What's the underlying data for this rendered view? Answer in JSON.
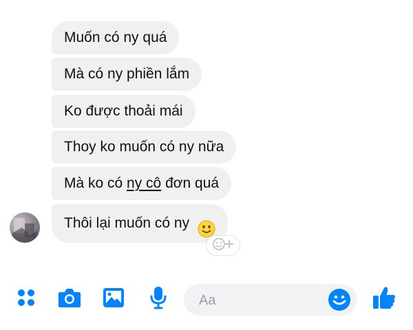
{
  "messages": [
    {
      "text": "Muốn có ny quá"
    },
    {
      "text": "Mà có ny phiền lắm"
    },
    {
      "text": "Ko được thoải mái"
    },
    {
      "text": "Thoy ko muốn có ny nữa"
    },
    {
      "pre": "Mà ko có ",
      "underlined": "ny cô",
      "post": " đơn quá"
    },
    {
      "text": "Thôi lại muốn có ny"
    }
  ],
  "composer": {
    "placeholder": "Aa"
  },
  "icons": {
    "menu": "grid-dots-icon",
    "camera": "camera-icon",
    "gallery": "image-icon",
    "mic": "microphone-icon",
    "emoji": "smiley-icon",
    "like": "thumbs-up-icon",
    "react": "add-reaction-icon"
  },
  "colors": {
    "accent": "#0084ff",
    "bubble": "#f0f0f0"
  }
}
